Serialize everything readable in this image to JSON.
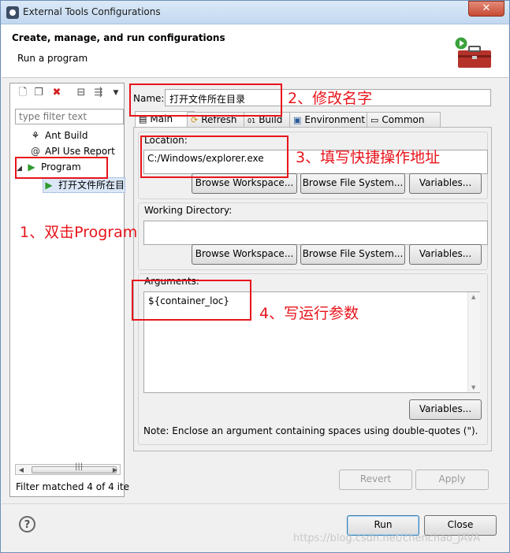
{
  "window": {
    "title": "External Tools Configurations",
    "close_glyph": "✕"
  },
  "header": {
    "title": "Create, manage, and run configurations",
    "subtitle": "Run a program"
  },
  "left": {
    "filter_placeholder": "type filter text",
    "tree": [
      {
        "label": "Ant Build"
      },
      {
        "label": "API Use Report"
      },
      {
        "label": "Program",
        "expander": "◢"
      },
      {
        "label": "打开文件所在目"
      }
    ],
    "scroll_grip": "|||",
    "status": "Filter matched 4 of 4 ite"
  },
  "right": {
    "name_label": "Name:",
    "name_value": "打开文件所在目录",
    "tabs": [
      {
        "label": "Main"
      },
      {
        "label": "Refresh"
      },
      {
        "label": "Build"
      },
      {
        "label": "Environment"
      },
      {
        "label": "Common"
      }
    ],
    "location": {
      "label": "Location:",
      "value": "C:/Windows/explorer.exe",
      "btn_workspace": "Browse Workspace...",
      "btn_filesystem": "Browse File System...",
      "btn_variables": "Variables..."
    },
    "workdir": {
      "label": "Working Directory:",
      "value": "",
      "btn_workspace": "Browse Workspace...",
      "btn_filesystem": "Browse File System...",
      "btn_variables": "Variables..."
    },
    "arguments": {
      "label": "Arguments:",
      "value": "${container_loc}",
      "btn_variables": "Variables..."
    },
    "note": "Note: Enclose an argument containing spaces using double-quotes (\").",
    "revert": "Revert",
    "apply": "Apply"
  },
  "footer": {
    "help": "?",
    "run": "Run",
    "close": "Close",
    "watermark": "https://blog.csdn.net/chenchao_JAVA"
  },
  "annotations": {
    "a1": "1、双击Program",
    "a2": "2、修改名字",
    "a3": "3、填写快捷操作地址",
    "a4": "4、写运行参数"
  },
  "colors": {
    "annotation": "#e8141b",
    "titlebar": "#c2d8f0"
  }
}
